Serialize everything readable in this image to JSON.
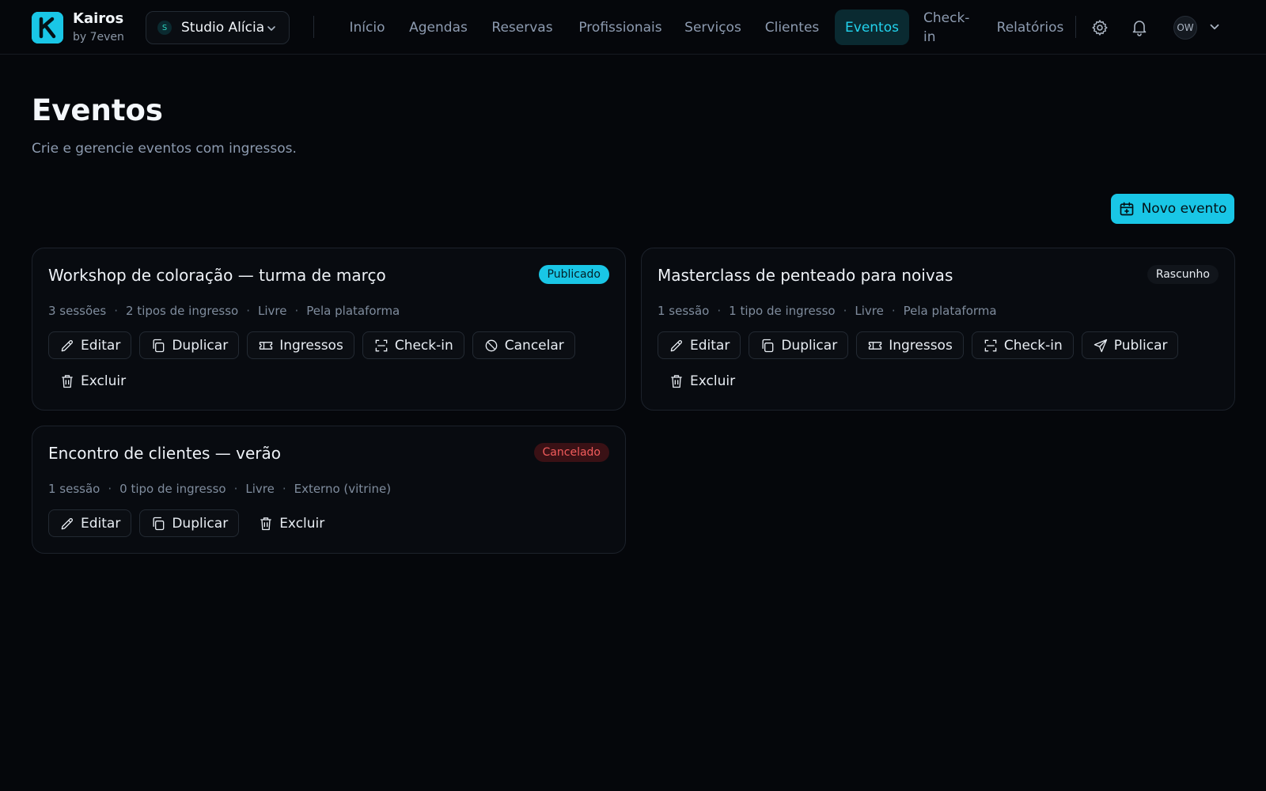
{
  "brand": {
    "name": "Kairos",
    "subtitle": "by 7even",
    "logo_letter": "K"
  },
  "workspace": {
    "initial": "S",
    "name": "Studio Alícia"
  },
  "nav": {
    "items": [
      {
        "label": "Início"
      },
      {
        "label": "Agendas"
      },
      {
        "label": "Reservas"
      },
      {
        "label": "Profissionais"
      },
      {
        "label": "Serviços"
      },
      {
        "label": "Clientes"
      },
      {
        "label": "Eventos",
        "active": true
      },
      {
        "label": "Check-in"
      },
      {
        "label": "Relatórios"
      }
    ],
    "settings_icon": "gear-icon",
    "notifications_icon": "bell-icon",
    "avatar_initials": "OW"
  },
  "page": {
    "title": "Eventos",
    "subtitle": "Crie e gerencie eventos com ingressos.",
    "new_button": "Novo evento"
  },
  "events": [
    {
      "title": "Workshop de coloração — turma de março",
      "status": "Publicado",
      "status_color": "#19c6e6",
      "meta": [
        "3 sessões",
        "2 tipos de ingresso",
        "Livre",
        "Pela plataforma"
      ],
      "actions": [
        "Editar",
        "Duplicar",
        "Ingressos",
        "Check-in",
        "Cancelar",
        "Excluir"
      ]
    },
    {
      "title": "Masterclass de penteado para noivas",
      "status": "Rascunho",
      "status_color": "#11151b",
      "meta": [
        "1 sessão",
        "1 tipo de ingresso",
        "Livre",
        "Pela plataforma"
      ],
      "actions": [
        "Editar",
        "Duplicar",
        "Ingressos",
        "Check-in",
        "Publicar",
        "Excluir"
      ]
    },
    {
      "title": "Encontro de clientes — verão",
      "status": "Cancelado",
      "status_color": "#f25c5c",
      "meta": [
        "1 sessão",
        "0 tipo de ingresso",
        "Livre",
        "Externo (vitrine)"
      ],
      "actions": [
        "Editar",
        "Duplicar",
        "Excluir"
      ]
    }
  ],
  "colors": {
    "accent": "#19c6e6",
    "background": "#05070b",
    "danger": "#f25c5c"
  }
}
